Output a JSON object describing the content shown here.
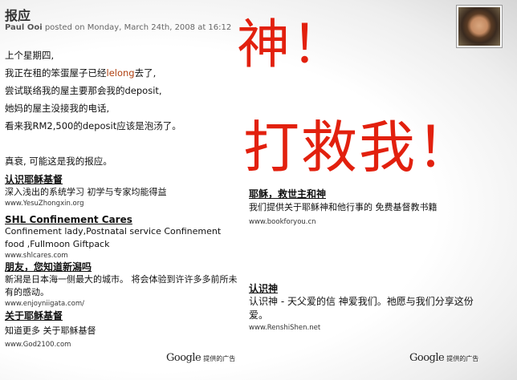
{
  "post": {
    "title": "报应",
    "author": "Paul Ooi",
    "posted_on": " posted on Monday, March 24th, 2008 at 16:12",
    "lines": [
      "上个星期四,",
      "我正在租的笨蛋屋子已经",
      "尝试联络我的屋主要那会我的deposit,",
      "她妈的屋主没接我的电话,",
      "看来我RM2,500的deposit应该是泡汤了。",
      "",
      "真衰, 可能这是我的报应。"
    ],
    "line2_link": "lelong",
    "line2_tail": "去了,"
  },
  "overlay": {
    "line1": "神！",
    "line2": "打救我！",
    "color": "#e2200e"
  },
  "ads_left": [
    {
      "title": "认识耶稣基督",
      "desc": "深入浅出的系统学习 初学与专家均能得益",
      "url": "www.YesuZhongxin.org"
    },
    {
      "title": "SHL Confinement Cares",
      "desc": "Confinement lady,Postnatal service Confinement food ,Fullmoon Giftpack",
      "url": "www.shlcares.com"
    },
    {
      "title": "朋友，您知道新潟吗",
      "desc": "新潟是日本海一侧最大的城市。 将会体验到许许多多前所未有的感动。",
      "url": "www.enjoyniigata.com/"
    },
    {
      "title": "关于耶稣基督",
      "desc": "知道更多 关于耶稣基督",
      "url": "www.God2100.com"
    }
  ],
  "ads_right": [
    {
      "title": "耶稣，救世主和神",
      "desc": "我们提供关于耶稣神和他行事的 免费基督教书籍",
      "url": "www.bookforyou.cn"
    },
    {
      "title": "认识神",
      "desc": "认识神 - 天父爱的信 神爱我们。祂愿与我们分享这份爱。",
      "url": "www.RenshiShen.net"
    }
  ],
  "footer": {
    "google": "Google",
    "provided": "提供的广告"
  }
}
